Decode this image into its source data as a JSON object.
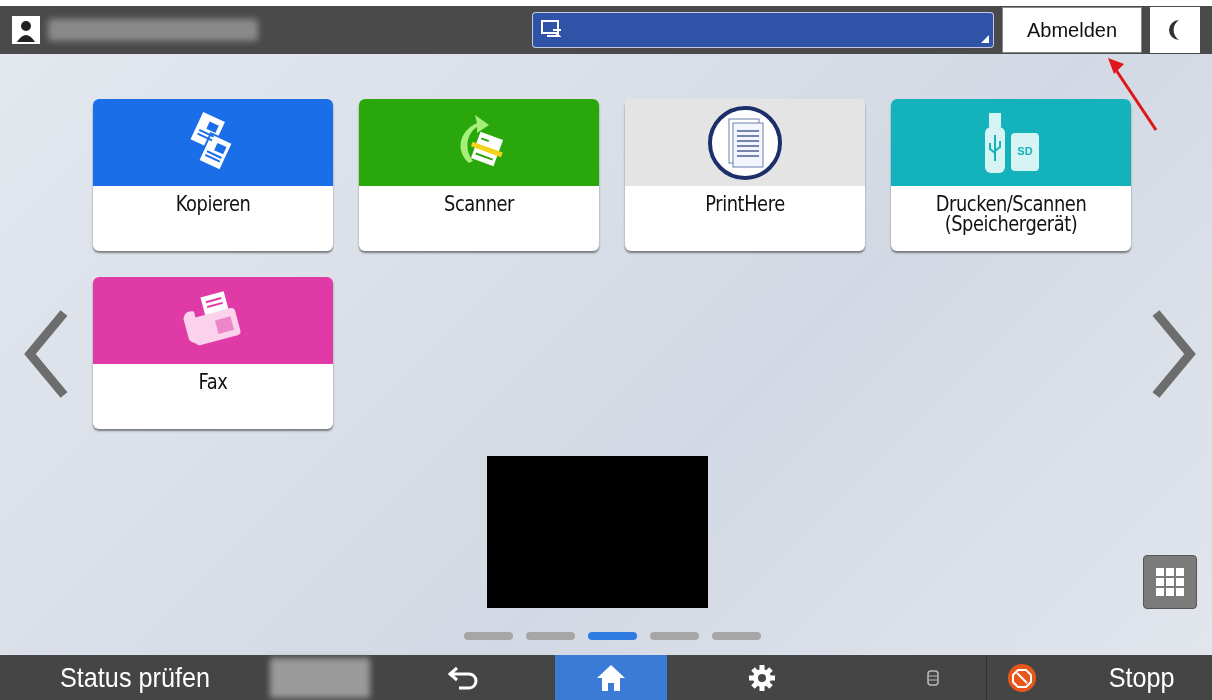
{
  "top_bar": {
    "logout": "Abmelden"
  },
  "tiles": [
    {
      "label": "Kopieren",
      "kind": "copy",
      "color": "#1a6ee8"
    },
    {
      "label": "Scanner",
      "kind": "scanner",
      "color": "#2aa70a"
    },
    {
      "label": "PrintHere",
      "kind": "printhere",
      "color": "#e4e4e4"
    },
    {
      "label": "Drucken/Scannen (Speichergerät)",
      "kind": "media",
      "color": "#14b3bb",
      "badge": "SD"
    },
    {
      "label": "Fax",
      "kind": "fax",
      "color": "#e03aa6"
    }
  ],
  "pages": [
    {
      "selected": false
    },
    {
      "selected": false
    },
    {
      "selected": true
    },
    {
      "selected": false
    },
    {
      "selected": false
    }
  ],
  "bottom_bar": {
    "status": "Status prüfen",
    "stop": "Stopp"
  }
}
